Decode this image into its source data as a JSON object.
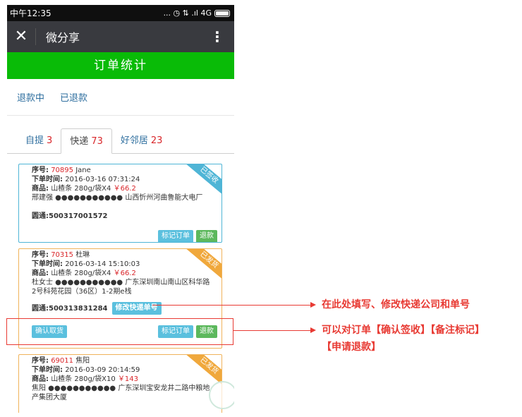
{
  "status_bar": {
    "time": "中午12:35",
    "icons_text": "... ◷ ⇅ .ıl 4G"
  },
  "title_bar": {
    "close_glyph": "✕",
    "title": "微分享",
    "menu_glyph": "⋮"
  },
  "header": {
    "title": "订单统计"
  },
  "filters": [
    "退款中",
    "已退款"
  ],
  "tabs": [
    {
      "label": "自提",
      "count": "3"
    },
    {
      "label": "快递",
      "count": "73"
    },
    {
      "label": "好邻居",
      "count": "23"
    }
  ],
  "orders": [
    {
      "status": "已签收",
      "seq_label": "序号:",
      "seq": "70895",
      "name": "Jane",
      "time_label": "下单时间:",
      "time": "2016-03-16 07:31:24",
      "product_label": "商品:",
      "product": "山楂条 280g/袋X4",
      "price": "￥66.2",
      "address": "邢建强 ●●●●●●●●●●● 山西忻州河曲鲁能大电厂",
      "tracking": "圆通:500317001572",
      "btn_mark": "标记订单",
      "btn_refund": "退款"
    },
    {
      "status": "已发货",
      "seq_label": "序号:",
      "seq": "70315",
      "name": "杜琳",
      "time_label": "下单时间:",
      "time": "2016-03-14 15:10:03",
      "product_label": "商品:",
      "product": "山楂条 280g/袋X4",
      "price": "￥66.2",
      "address": "杜女士 ●●●●●●●●●●● 广东深圳南山南山区科华路2号科苑花园（36区）1-2期e栈",
      "tracking": "圆通:500313831284",
      "btn_edit": "修改快递单号",
      "btn_confirm": "确认取货",
      "btn_mark": "标记订单",
      "btn_refund": "退款"
    },
    {
      "status": "已发货",
      "seq_label": "序号:",
      "seq": "69011",
      "name": "焦阳",
      "time_label": "下单时间:",
      "time": "2016-03-09 20:14:59",
      "product_label": "商品:",
      "product": "山楂条 280g/袋X10",
      "price": "￥143",
      "address": "焦阳 ●●●●●●●●●●● 广东深圳宝安龙井二路中粮地产集团大厦"
    }
  ],
  "annotations": {
    "note1": "在此处填写、修改快递公司和单号",
    "note2_line1": "可以对订单【确认签收】【备注标记】",
    "note2_line2": "【申请退款】"
  },
  "colors": {
    "title_bar": "#393a3f",
    "header_green": "#09bb07",
    "accent_blue": "#5bc0de",
    "accent_green": "#5cb85c",
    "price_red": "#d9262a",
    "annotation_red": "#e83a33"
  }
}
